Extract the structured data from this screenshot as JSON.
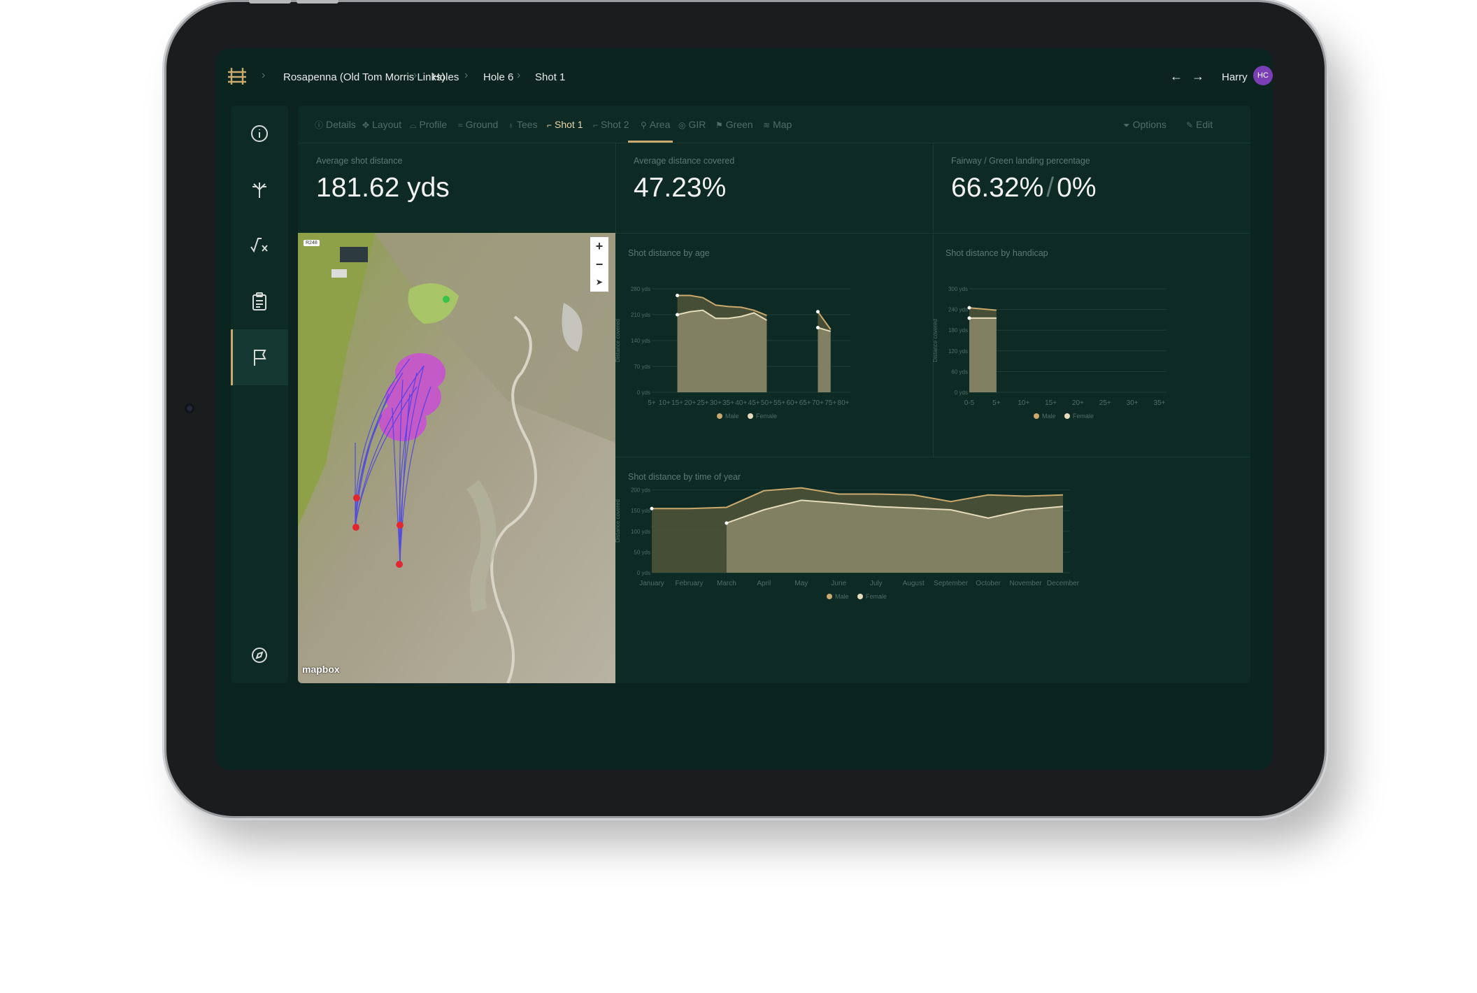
{
  "breadcrumb": [
    "Rosapenna (Old Tom Morris Links)",
    "Holes",
    "Hole 6",
    "Shot 1"
  ],
  "user": {
    "name": "Harry",
    "initials": "HC"
  },
  "tabs": [
    {
      "label": "Details",
      "icon": "info-icon"
    },
    {
      "label": "Layout",
      "icon": "move-icon"
    },
    {
      "label": "Profile",
      "icon": "profile-icon"
    },
    {
      "label": "Ground",
      "icon": "ground-icon"
    },
    {
      "label": "Tees",
      "icon": "tee-icon"
    },
    {
      "label": "Shot 1",
      "icon": "club-icon",
      "active": true
    },
    {
      "label": "Shot 2",
      "icon": "club-icon"
    },
    {
      "label": "Area",
      "icon": "pin-icon"
    },
    {
      "label": "GIR",
      "icon": "target-icon"
    },
    {
      "label": "Green",
      "icon": "flag-icon"
    },
    {
      "label": "Map",
      "icon": "layers-icon"
    }
  ],
  "actions": {
    "options": "Options",
    "edit": "Edit"
  },
  "stats": [
    {
      "label": "Average shot distance",
      "value": "181.62 yds"
    },
    {
      "label": "Average distance covered",
      "value": "47.23%"
    },
    {
      "label": "Fairway / Green landing percentage",
      "value_a": "66.32%",
      "value_b": "0%"
    }
  ],
  "map": {
    "road": "R248",
    "attribution": "mapbox",
    "zoom_in": "+",
    "zoom_out": "−"
  },
  "colors": {
    "male": "#c9a96e",
    "female": "#e6dcbd",
    "accent": "#c9a96e",
    "background": "#0e2a24"
  },
  "chart_data": [
    {
      "type": "area",
      "title": "Shot distance by age",
      "ylabel": "Distance covered",
      "yticks": [
        "0 yds",
        "70 yds",
        "140 yds",
        "210 yds",
        "280 yds"
      ],
      "ylim": [
        0,
        280
      ],
      "categories": [
        "5+",
        "10+",
        "15+",
        "20+",
        "25+",
        "30+",
        "35+",
        "40+",
        "45+",
        "50+",
        "55+",
        "60+",
        "65+",
        "70+",
        "75+",
        "80+"
      ],
      "series": [
        {
          "name": "Male",
          "values": [
            null,
            null,
            262,
            262,
            256,
            236,
            232,
            230,
            222,
            208,
            null,
            null,
            null,
            218,
            170,
            null
          ]
        },
        {
          "name": "Female",
          "values": [
            null,
            null,
            210,
            218,
            222,
            200,
            200,
            205,
            215,
            195,
            null,
            null,
            null,
            175,
            165,
            null
          ]
        }
      ],
      "legend": [
        "Male",
        "Female"
      ]
    },
    {
      "type": "area",
      "title": "Shot distance by handicap",
      "ylabel": "Distance covered",
      "yticks": [
        "0 yds",
        "60 yds",
        "120 yds",
        "180 yds",
        "240 yds",
        "300 yds"
      ],
      "ylim": [
        0,
        300
      ],
      "categories": [
        "0-5",
        "5+",
        "10+",
        "15+",
        "20+",
        "25+",
        "30+",
        "35+"
      ],
      "series": [
        {
          "name": "Male",
          "values": [
            245,
            238,
            null,
            null,
            null,
            null,
            null,
            null
          ]
        },
        {
          "name": "Female",
          "values": [
            215,
            215,
            null,
            null,
            null,
            null,
            null,
            null
          ]
        }
      ],
      "legend": [
        "Male",
        "Female"
      ]
    },
    {
      "type": "area",
      "title": "Shot distance by time of year",
      "ylabel": "Distance covered",
      "yticks": [
        "0 yds",
        "50 yds",
        "100 yds",
        "150 yds",
        "200 yds",
        "250 yds"
      ],
      "ylim": [
        0,
        250
      ],
      "categories": [
        "January",
        "February",
        "March",
        "April",
        "May",
        "June",
        "July",
        "August",
        "September",
        "October",
        "November",
        "December"
      ],
      "series": [
        {
          "name": "Male",
          "values": [
            155,
            155,
            158,
            198,
            205,
            190,
            190,
            188,
            172,
            188,
            185,
            188
          ]
        },
        {
          "name": "Female",
          "values": [
            null,
            null,
            120,
            152,
            175,
            168,
            160,
            156,
            152,
            132,
            152,
            160
          ]
        }
      ],
      "legend": [
        "Male",
        "Female"
      ]
    }
  ]
}
